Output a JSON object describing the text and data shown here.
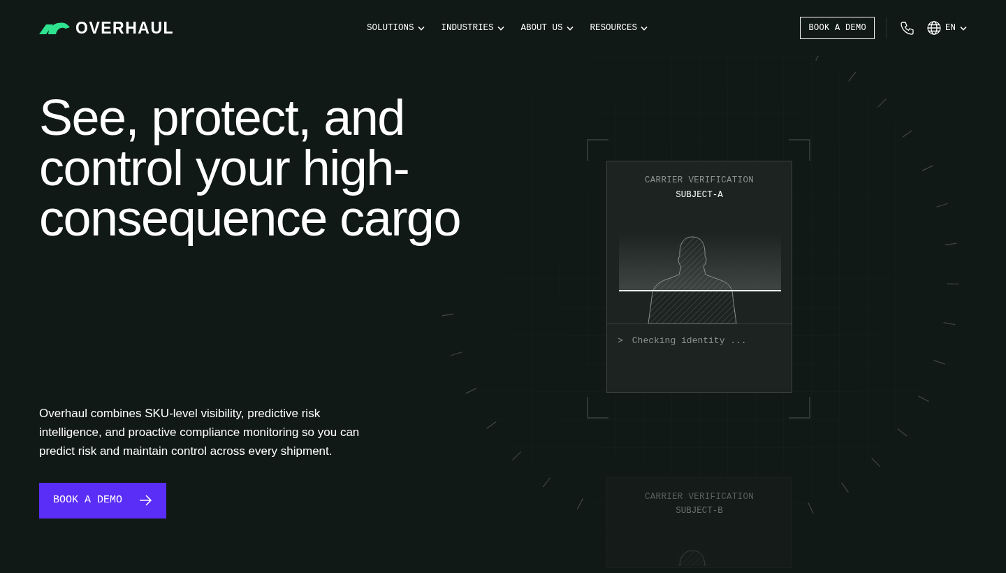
{
  "nav": {
    "logo": "OVERHAUL",
    "menu": [
      {
        "label": "SOLUTIONS"
      },
      {
        "label": "INDUSTRIES"
      },
      {
        "label": "ABOUT US"
      },
      {
        "label": "RESOURCES"
      }
    ],
    "demo_button": "BOOK A DEMO",
    "language": "EN"
  },
  "hero": {
    "headline": "See, protect, and control your high-consequence cargo",
    "description": "Overhaul combines SKU-level visibility, predictive risk intelligence, and proactive compliance monitoring so you can predict risk and maintain control across every shipment.",
    "cta": "BOOK A DEMO"
  },
  "verification_cards": [
    {
      "title": "CARRIER VERIFICATION",
      "subject": "SUBJECT-A",
      "prompt": ">",
      "status": "Checking identity ...",
      "dimmed": false
    },
    {
      "title": "CARRIER VERIFICATION",
      "subject": "SUBJECT-B",
      "dimmed": true
    }
  ]
}
